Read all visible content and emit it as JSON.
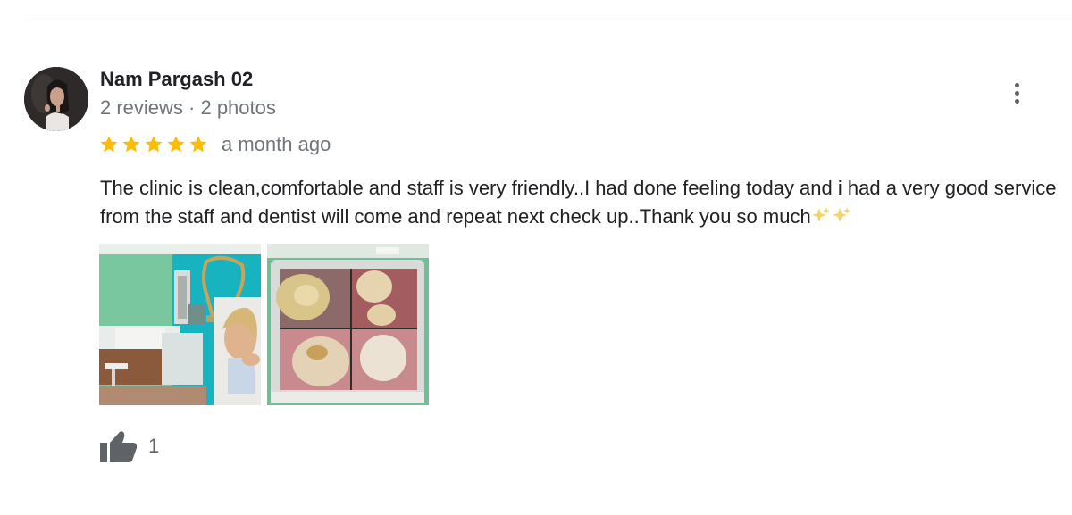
{
  "review": {
    "author_name": "Nam Pargash 02",
    "author_meta": "2 reviews · 2 photos",
    "rating": 5,
    "rating_max": 5,
    "date": "a month ago",
    "text": "The clinic is clean,comfortable and staff is very friendly..I had done feeling today and i had a very good service from the staff and dentist will come and repeat next check up..Thank you so much",
    "text_emoji": "✨✨",
    "photos": [
      {
        "name": "clinic-reception-photo"
      },
      {
        "name": "dental-xray-monitor-photo"
      }
    ],
    "like_count": "1"
  },
  "colors": {
    "star": "#fbbc04",
    "name": "#202124",
    "secondary_text": "#70757a",
    "icon": "#5f6368",
    "divider": "#e8eaed"
  },
  "icons": {
    "menu": "more-vert-icon",
    "like": "thumb-up-icon",
    "star": "star-icon"
  }
}
